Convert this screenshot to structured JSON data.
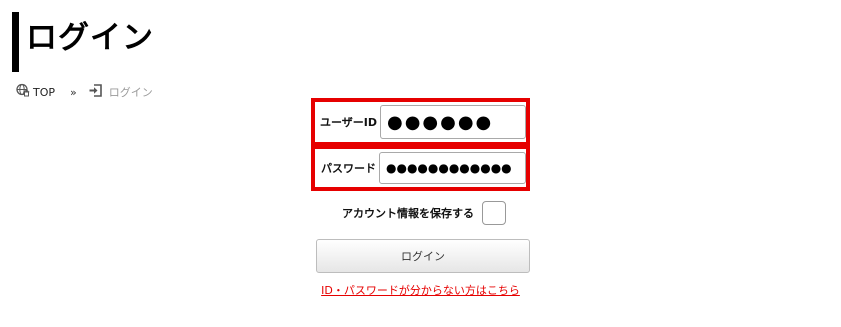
{
  "page": {
    "title": "ログイン"
  },
  "breadcrumb": {
    "home_icon": "globe-home-icon",
    "home_label": "TOP",
    "separator": "»",
    "current_icon": "sign-in-icon",
    "current_label": "ログイン"
  },
  "form": {
    "user_id": {
      "label": "ユーザーID",
      "value": "●●●●●●"
    },
    "password": {
      "label": "パスワード",
      "value": "●●●●●●●●●●●●"
    },
    "save_account": {
      "label": "アカウント情報を保存する",
      "checked": false
    },
    "login_button": "ログイン",
    "forgot_link": "ID・パスワードが分からない方はこちら"
  },
  "colors": {
    "highlight": "#e60000",
    "link": "#e60000",
    "title_bar": "#000000"
  }
}
